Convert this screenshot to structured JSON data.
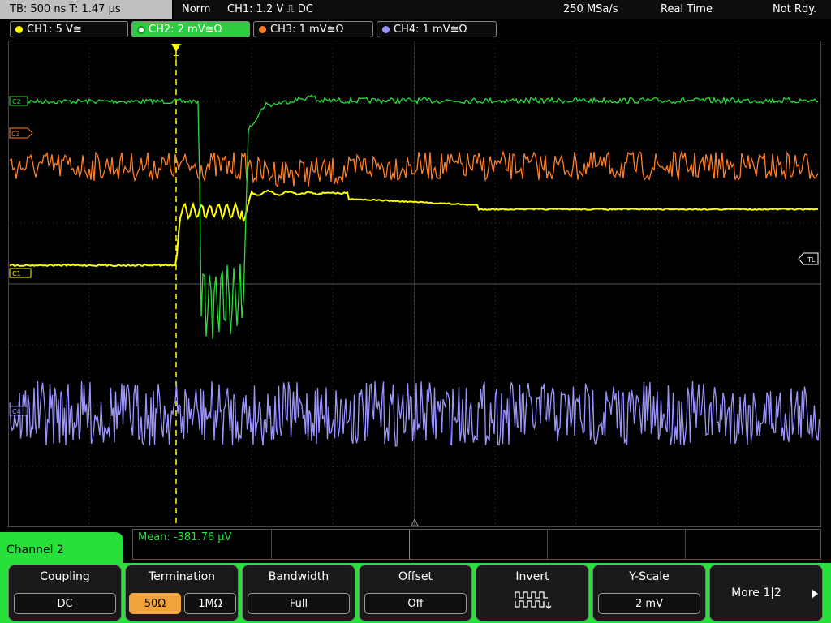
{
  "topbar": {
    "timebase": "TB: 500 ns   T: 1.47 µs",
    "mode": "Norm",
    "trigger": "CH1: 1.2 V ⎍ DC",
    "sample_rate": "250 MSa/s",
    "acq": "Real Time",
    "status": "Not Rdy."
  },
  "channels": [
    {
      "label": "CH1: 5 V≅",
      "color": "#ffff00"
    },
    {
      "label": "CH2: 2 mV≅Ω",
      "color": "#27e03a"
    },
    {
      "label": "CH3: 1 mV≅Ω",
      "color": "#ff7f27"
    },
    {
      "label": "CH4: 1 mV≅Ω",
      "color": "#9b95ff"
    }
  ],
  "markers": {
    "c2": "C2",
    "c3": "C3",
    "c1": "C1",
    "c4": "C4",
    "tl": "TL",
    "trig": "T"
  },
  "panel": {
    "title": "Channel 2",
    "mean": "Mean: -381.76 µV"
  },
  "softkeys": {
    "coupling": {
      "label": "Coupling",
      "value": "DC"
    },
    "termination": {
      "label": "Termination",
      "opt1": "50Ω",
      "opt2": "1MΩ"
    },
    "bandwidth": {
      "label": "Bandwidth",
      "value": "Full"
    },
    "offset": {
      "label": "Offset",
      "value": "Off"
    },
    "invert": {
      "label": "Invert"
    },
    "yscale": {
      "label": "Y-Scale",
      "value": "2 mV"
    },
    "more": {
      "label": "More 1|2"
    }
  },
  "colors": {
    "accent": "#27e03a",
    "ch1": "#ffff00",
    "ch2": "#27e03a",
    "ch3": "#ff7f27",
    "ch4": "#9b95ff"
  }
}
